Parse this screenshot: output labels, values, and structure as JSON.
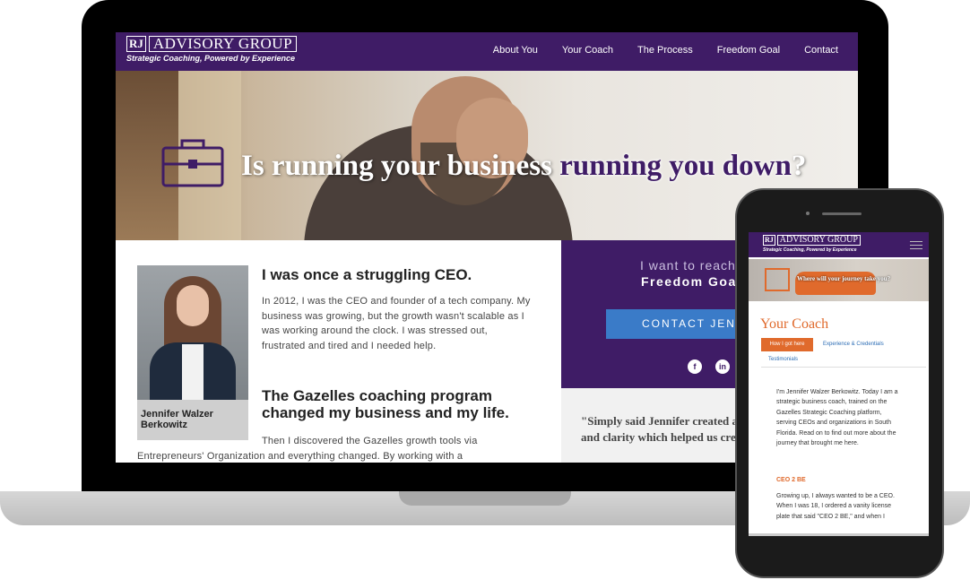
{
  "desktop": {
    "logo": {
      "mark": "RJ",
      "name": "ADVISORY GROUP",
      "tagline": "Strategic Coaching, Powered by Experience"
    },
    "nav": [
      "About You",
      "Your Coach",
      "The Process",
      "Freedom Goal",
      "Contact"
    ],
    "hero": {
      "headline_part1": "Is running your business ",
      "headline_part2": "running you down",
      "headline_part3": "?"
    },
    "profile": {
      "name": "Jennifer Walzer Berkowitz"
    },
    "section1": {
      "heading": "I was once a struggling CEO.",
      "body": "In 2012, I was the CEO and founder of a tech company. My business was growing, but the growth wasn't scalable as I was working around the clock. I was stressed out, frustrated and tired and I needed help."
    },
    "section2": {
      "heading": "The Gazelles coaching program changed my business and my life.",
      "body": "Then I discovered the Gazelles growth tools via Entrepreneurs' Organization and everything changed. By working with a"
    },
    "cta": {
      "line1": "I want to reach",
      "line2": "Freedom Goal",
      "button": "CONTACT JENNIFER"
    },
    "social": [
      "f",
      "in"
    ],
    "quote": "\"Simply said Jennifer created a structured approach and clarity which helped us create organized,"
  },
  "mobile": {
    "logo": {
      "mark": "RJ",
      "name": "ADVISORY GROUP",
      "tagline": "Strategic Coaching, Powered by Experience"
    },
    "banner_text": "Where will your journey take you?",
    "page_title": "Your Coach",
    "tabs": [
      "How I got here",
      "Experience & Credentials",
      "Testimonials"
    ],
    "intro": "I'm Jennifer Walzer Berkowitz. Today I am a strategic business coach, trained on the Gazelles Strategic Coaching platform, serving CEOs and organizations in South Florida. Read on to find out more about the journey that brought me here.",
    "subheading": "CEO 2 BE",
    "body": "Growing up, I always wanted to be a CEO. When I was 18, I ordered a vanity license plate that said \"CEO 2 BE,\" and when I"
  },
  "colors": {
    "brand_purple": "#3f1c66",
    "accent_orange": "#e06a2c",
    "button_blue": "#3a7bc8"
  }
}
